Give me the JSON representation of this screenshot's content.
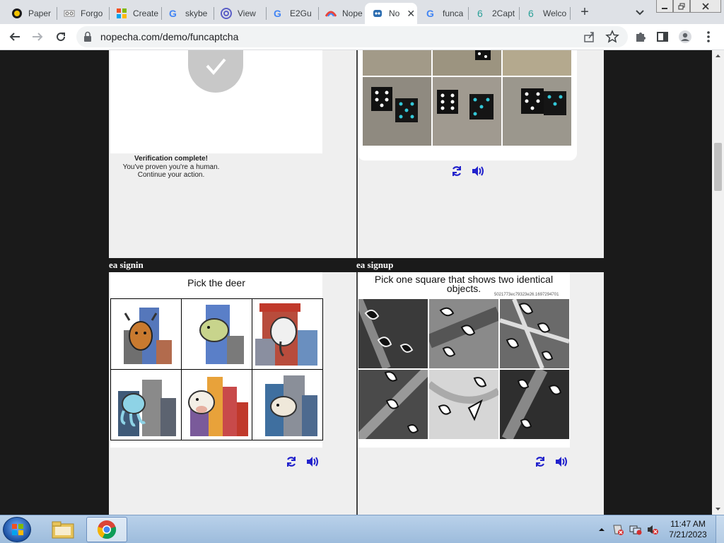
{
  "browser": {
    "tabs": [
      {
        "title": "Paper",
        "icon": "paper-icon"
      },
      {
        "title": "Forgo",
        "icon": "forgot-icon"
      },
      {
        "title": "Create",
        "icon": "windows-icon"
      },
      {
        "title": "skybe",
        "icon": "google-icon"
      },
      {
        "title": "View",
        "icon": "at-icon"
      },
      {
        "title": "E2Gu",
        "icon": "google-icon"
      },
      {
        "title": "Nope",
        "icon": "nopecha-icon"
      },
      {
        "title": "No",
        "icon": "robot-icon",
        "active": true
      },
      {
        "title": "funca",
        "icon": "google-icon"
      },
      {
        "title": "2Capt",
        "icon": "captcha-icon"
      },
      {
        "title": "Welco",
        "icon": "captcha-icon"
      }
    ],
    "new_tab": "+",
    "close_tab": "✕",
    "url": "nopecha.com/demo/funcaptcha"
  },
  "page": {
    "verification": {
      "title": "Verification complete!",
      "line1": "You've proven you're a human.",
      "line2": "Continue your action."
    },
    "sections": {
      "left_label": "ea signin",
      "right_label": "ea signup"
    },
    "signin_captcha": {
      "prompt": "Pick the deer",
      "tiles": [
        "deer-on-building",
        "turtle-on-building",
        "elephant-on-building",
        "octopus-on-building",
        "cow-on-building",
        "sheep-on-building"
      ]
    },
    "signup_captcha": {
      "prompt_line1": "Pick one square that shows two identical",
      "prompt_line2": "objects.",
      "id_text": "5021773ec79323e26.1697294701",
      "tiles": [
        "tile-1",
        "tile-2",
        "tile-3",
        "tile-4",
        "tile-5",
        "tile-6"
      ]
    },
    "dice_tiles": [
      "dice-1",
      "dice-2",
      "dice-3"
    ]
  },
  "taskbar": {
    "time": "11:47 AM",
    "date": "7/21/2023"
  },
  "colors": {
    "accent_blue": "#1a0dab",
    "control_blue": "#2222cc",
    "page_bg": "#1a1a1a"
  }
}
